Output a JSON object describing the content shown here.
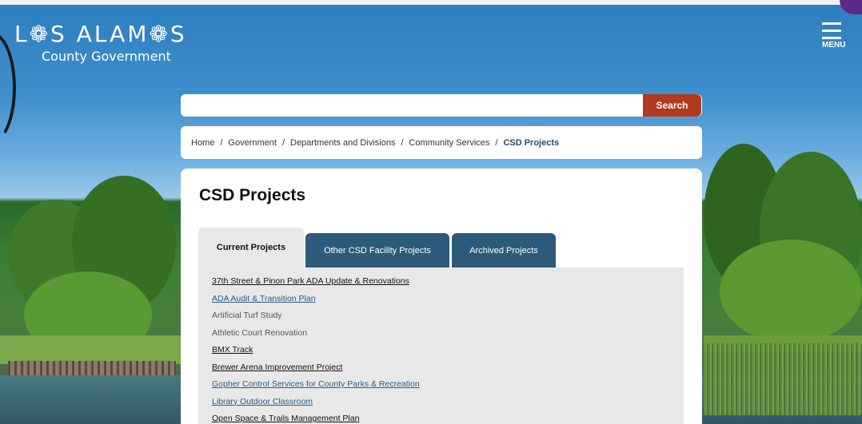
{
  "brand": {
    "logo_main": "L❁S ALAM❁S",
    "logo_sub": "County Government"
  },
  "menu": {
    "label": "MENU"
  },
  "search": {
    "placeholder": "",
    "value": "",
    "button_label": "Search"
  },
  "breadcrumb": {
    "items": [
      "Home",
      "Government",
      "Departments and Divisions",
      "Community Services"
    ],
    "separator": "/",
    "current": "CSD Projects"
  },
  "page": {
    "title": "CSD Projects"
  },
  "tabs": [
    {
      "label": "Current Projects",
      "active": true
    },
    {
      "label": "Other CSD Facility Projects",
      "active": false
    },
    {
      "label": "Archived Projects",
      "active": false
    }
  ],
  "projects": [
    {
      "label": "37th Street & Pinon Park ADA Update & Renovations",
      "style": "link-dark"
    },
    {
      "label": "ADA Audit & Transition Plan",
      "style": "link-blue"
    },
    {
      "label": "Artificial Turf Study",
      "style": "plain"
    },
    {
      "label": "Athletic Court Renovation",
      "style": "plain"
    },
    {
      "label": "BMX Track",
      "style": "link-dark"
    },
    {
      "label": "Brewer Arena Improvement Project",
      "style": "link-dark"
    },
    {
      "label": "Gopher Control Services for County Parks & Recreation",
      "style": "link-blue"
    },
    {
      "label": "Library Outdoor Classroom",
      "style": "link-blue"
    },
    {
      "label": "Open Space & Trails Management Plan",
      "style": "link-dark"
    }
  ],
  "colors": {
    "search_button": "#b13a1e",
    "tab_inactive": "#2d5a7a",
    "tab_active": "#e8e8e8",
    "breadcrumb_current": "#2a4a6a",
    "link_blue": "#2a5a8a"
  }
}
